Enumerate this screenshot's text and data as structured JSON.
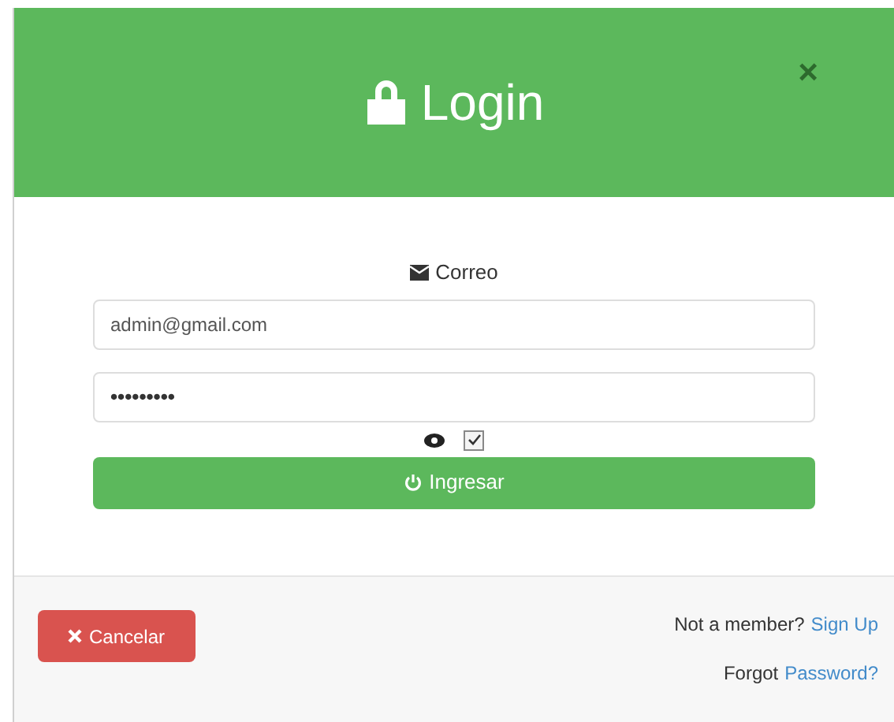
{
  "header": {
    "title": "Login",
    "close": "×"
  },
  "form": {
    "label": "Correo",
    "email": "admin@gmail.com",
    "password": "•••••••••",
    "show_password": {
      "checked": true
    },
    "submit": "Ingresar"
  },
  "footer": {
    "cancel": "Cancelar",
    "signup_prompt": "Not a member?",
    "signup_link": "Sign Up",
    "forgot_prompt": "Forgot",
    "forgot_link": "Password?"
  }
}
